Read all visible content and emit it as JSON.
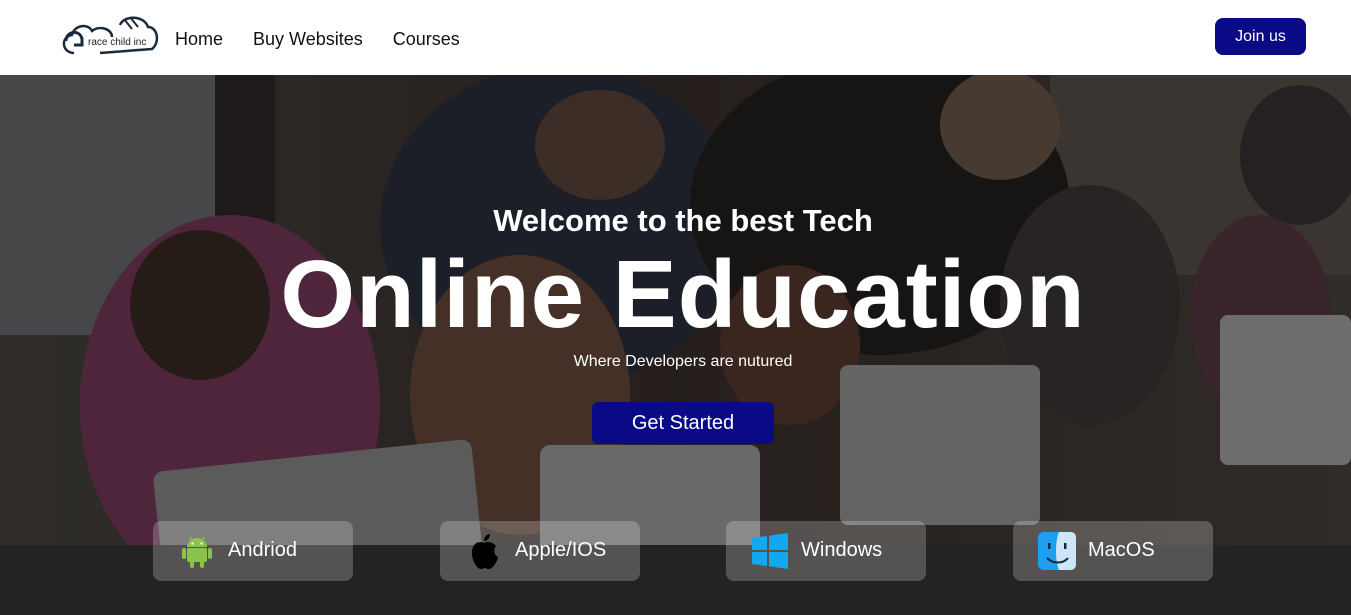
{
  "navbar": {
    "logo_text": "race child inc",
    "links": [
      "Home",
      "Buy Websites",
      "Courses"
    ],
    "join_label": "Join us",
    "accent_color": "#0a0a86"
  },
  "hero": {
    "kicker": "Welcome to the best Tech",
    "title": "Online Education",
    "subtitle": "Where Developers are nutured",
    "cta_label": "Get Started"
  },
  "platforms": [
    {
      "label": "Andriod",
      "icon": "android-icon"
    },
    {
      "label": "Apple/IOS",
      "icon": "apple-icon"
    },
    {
      "label": "Windows",
      "icon": "windows-icon"
    },
    {
      "label": "MacOS",
      "icon": "macos-finder-icon"
    }
  ]
}
